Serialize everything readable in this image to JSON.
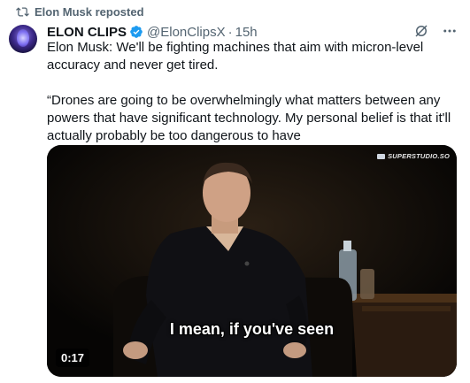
{
  "repost": {
    "label": "Elon Musk reposted",
    "icon": "repost-icon"
  },
  "author": {
    "display_name": "ELON CLIPS",
    "handle": "@ElonClipsX",
    "separator": "·",
    "time": "15h",
    "verified_color": "#1d9bf0"
  },
  "header_icons": [
    "grok-icon",
    "more-icon"
  ],
  "tweet": {
    "paragraph1": "Elon Musk: We'll be fighting machines that aim with micron-level accuracy and never get tired.",
    "paragraph2": "“Drones are going to be overwhelmingly what matters between any powers that have significant technology. My personal belief is that it'll actually probably be too dangerous to have"
  },
  "media": {
    "watermark": "SUPERSTUDIO.SO",
    "subtitle": "I mean, if you've seen",
    "duration": "0:17"
  }
}
